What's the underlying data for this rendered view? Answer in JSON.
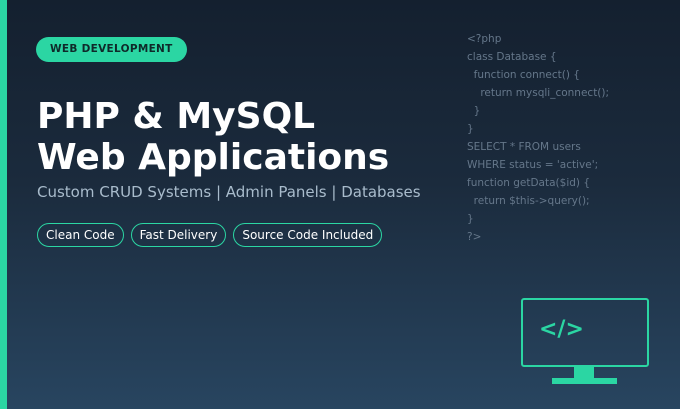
{
  "badge": "WEB DEVELOPMENT",
  "headline": {
    "line1": "PHP & MySQL",
    "line2": "Web Applications"
  },
  "subtitle": "Custom CRUD Systems | Admin Panels | Databases",
  "tags": [
    "Clean Code",
    "Fast Delivery",
    "Source Code Included"
  ],
  "code_lines": [
    "<?php",
    "class Database {",
    "  function connect() {",
    "    return mysqli_connect();",
    "  }",
    "}",
    "SELECT * FROM users",
    "WHERE status = 'active';",
    "function getData($id) {",
    "  return $this->query();",
    "}",
    "?>"
  ],
  "monitor_icon": {
    "icon": "code-brackets-icon",
    "text": "</>"
  },
  "colors": {
    "accent": "#2bd6a3",
    "background_top": "#14202f",
    "background_bottom": "#284560",
    "headline": "#ffffff",
    "subtitle": "#a9bccc",
    "code": "#65778a"
  }
}
